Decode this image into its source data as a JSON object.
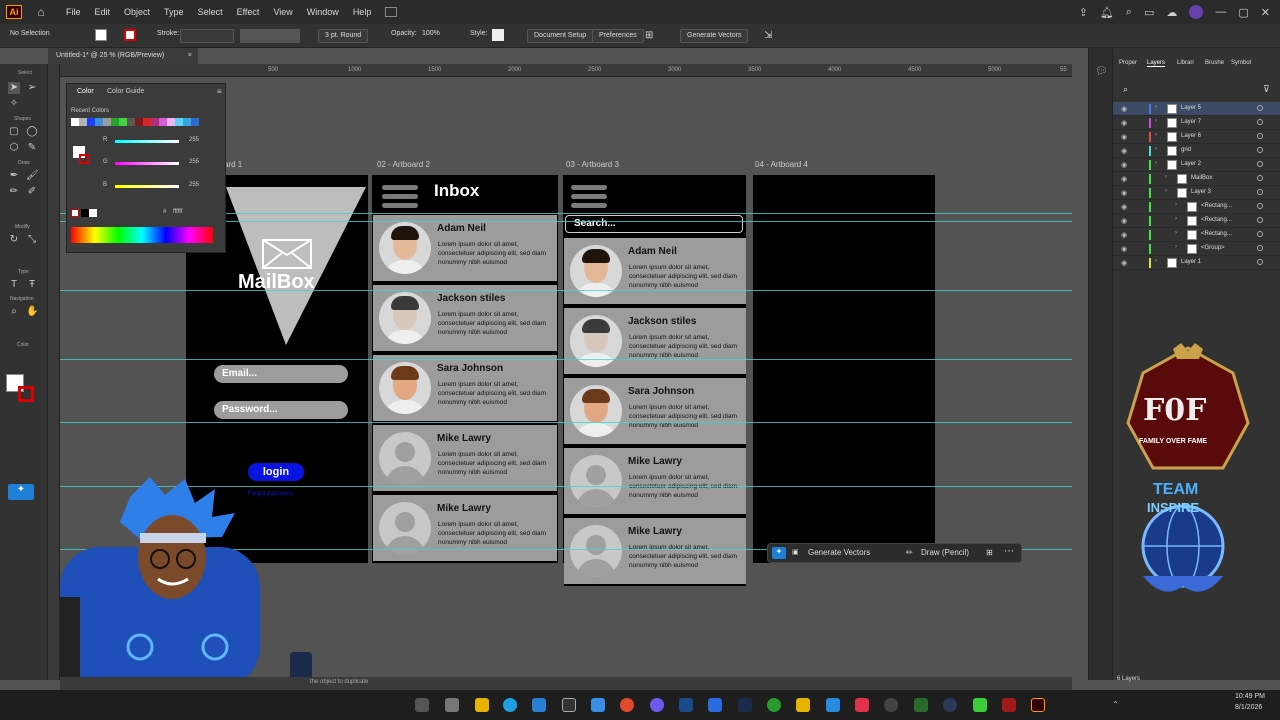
{
  "menubar": {
    "logo": "Ai",
    "items": [
      "File",
      "Edit",
      "Object",
      "Type",
      "Select",
      "Effect",
      "View",
      "Window",
      "Help"
    ]
  },
  "controlbar": {
    "selection": "No Selection",
    "stroke_label": "Stroke:",
    "stroke_profile": "3 pt. Round",
    "opacity_label": "Opacity:",
    "opacity_value": "100%",
    "style_label": "Style:",
    "document_setup": "Document Setup",
    "preferences": "Preferences",
    "generate_vectors": "Generate Vectors"
  },
  "doc_tab": {
    "title": "Untitled-1* @ 25 % (RGB/Preview)",
    "close": "×"
  },
  "toolbar": {
    "labels": [
      "Select",
      "Shapes",
      "Draw",
      "Modify",
      "Type",
      "Navigation",
      "Color"
    ]
  },
  "rulers": {
    "top_ticks": [
      "500",
      "1000",
      "1500",
      "2000",
      "2500",
      "3000",
      "3500",
      "4000",
      "4500",
      "5000",
      "55"
    ]
  },
  "color_panel": {
    "tab_color": "Color",
    "tab_guide": "Color Guide",
    "recent_label": "Recent Colors",
    "r_label": "R",
    "r_value": "255",
    "g_label": "G",
    "g_value": "255",
    "b_label": "B",
    "b_value": "255",
    "hex_label": "#",
    "hex_value": "ffffff",
    "swatches": [
      "#ffffff",
      "#b3b3b3",
      "#1e3cff",
      "#3e8ede",
      "#9d9d9d",
      "#2ca02c",
      "#3fd43f",
      "#595959",
      "#7a1c1c",
      "#d62728",
      "#b0307a",
      "#d65fd6",
      "#f0b3f0",
      "#5fd3f0",
      "#3aa6de",
      "#2f6ad4"
    ]
  },
  "artboards": [
    {
      "label": "ard 1"
    },
    {
      "label": "02 - Artboard 2"
    },
    {
      "label": "03 - Artboard 3"
    },
    {
      "label": "04 - Artboard 4"
    }
  ],
  "artboard1": {
    "title": "MailBox",
    "email_placeholder": "Email...",
    "password_placeholder": "Password...",
    "login": "login",
    "forgot": "Forgot password"
  },
  "artboard2": {
    "header": "Inbox",
    "contacts": [
      {
        "name": "Adam Neil",
        "text": "Lorem ipsum dolor sit amet, consectetuer adipiscing elit, sed diam nonummy nibh euismod",
        "photo": true,
        "skin": "#e3b898",
        "hair": "#1e140c"
      },
      {
        "name": "Jackson stiles",
        "text": "Lorem ipsum dolor sit amet, consectetuer adipiscing elit, sed diam nonummy nibh euismod",
        "photo": true,
        "skin": "#d8c8bc",
        "hair": "#3a3a3a"
      },
      {
        "name": "Sara Johnson",
        "text": "Lorem ipsum dolor sit amet, consectetuer adipiscing elit, sed diam nonummy nibh euismod",
        "photo": true,
        "skin": "#e2a883",
        "hair": "#6b3a1a"
      },
      {
        "name": "Mike Lawry",
        "text": "Lorem ipsum dolor sit amet, consectetuer adipiscing elit, sed diam nonummy nibh euismod",
        "photo": false
      },
      {
        "name": "Mike Lawry",
        "text": "Lorem ipsum dolor sit amet, consectetuer adipiscing elit, sed diam nonummy nibh euismod",
        "photo": false
      }
    ]
  },
  "artboard3": {
    "search_placeholder": "Search...",
    "contacts": [
      {
        "name": "Adam Neil",
        "text": "Lorem ipsum dolor sit amet, consectetuer adipiscing elit, sed diam nonummy nibh euismod",
        "photo": true,
        "skin": "#e3b898",
        "hair": "#1e140c"
      },
      {
        "name": "Jackson stiles",
        "text": "Lorem ipsum dolor sit amet, consectetuer adipiscing elit, sed diam nonummy nibh euismod",
        "photo": true,
        "skin": "#d8c8bc",
        "hair": "#3a3a3a"
      },
      {
        "name": "Sara Johnson",
        "text": "Lorem ipsum dolor sit amet, consectetuer adipiscing elit, sed diam nonummy nibh euismod",
        "photo": true,
        "skin": "#e2a883",
        "hair": "#6b3a1a"
      },
      {
        "name": "Mike Lawry",
        "text": "Lorem ipsum dolor sit amet, consectetuer adipiscing elit, sed diam nonummy nibh euismod",
        "photo": false
      },
      {
        "name": "Mike Lawry",
        "text": "Lorem ipsum dolor sit amet, consectetuer adipiscing elit, sed diam nonummy nibh euismod",
        "photo": false
      }
    ]
  },
  "context_bar": {
    "generate_vectors": "Generate Vectors",
    "draw": "Draw (Pencil)"
  },
  "right_panel": {
    "tabs": [
      "Proper",
      "Layers",
      "Librari",
      "Brushe",
      "Symbol"
    ],
    "active_tab": "Layers",
    "layers": [
      "Layer 5",
      "Layer 7",
      "Layer 6",
      "grid",
      "Layer 2",
      "MailBox",
      "Layer 3",
      "<Rectang...",
      "<Rectang...",
      "<Rectang...",
      "<Group>",
      "Layer 1"
    ],
    "layer_count": "6 Layers"
  },
  "overlay": {
    "brand1_top": "F0F",
    "brand1_sub": "FAMILY OVER FAME",
    "brand2_top": "TEAM",
    "brand2_sub": "INSPIRE"
  },
  "statusbar": {
    "hint": "the object to duplicate"
  },
  "taskbar": {
    "time": "10:49 PM",
    "date": "8/1/2026"
  },
  "colors": {
    "accent_login": "#0a14e0",
    "guide": "#3fd6c8",
    "row_bg": "#9c9c9c"
  }
}
